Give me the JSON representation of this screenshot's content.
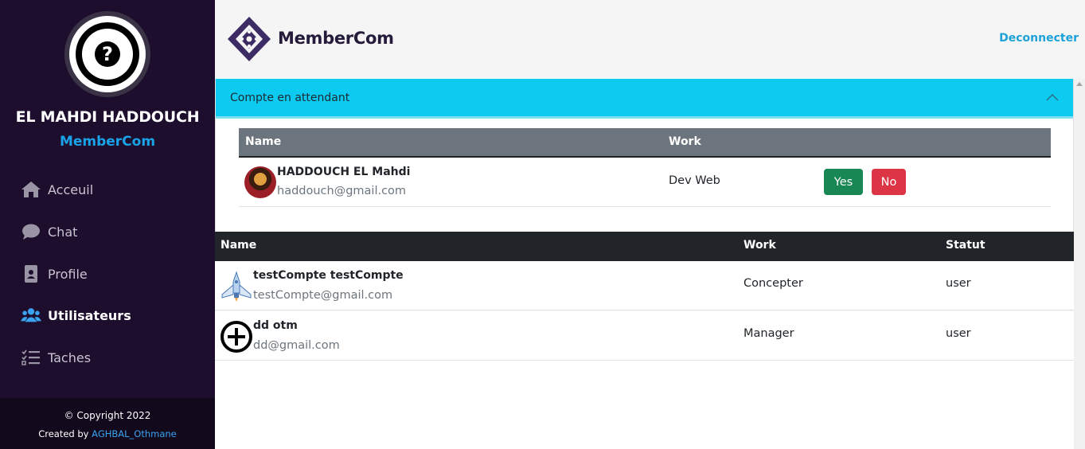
{
  "sidebar": {
    "user_name": "EL MAHDI HADDOUCH",
    "brand": "MemberCom",
    "nav": [
      {
        "label": "Acceuil",
        "icon": "home-icon"
      },
      {
        "label": "Chat",
        "icon": "chat-icon"
      },
      {
        "label": "Profile",
        "icon": "profile-badge-icon"
      },
      {
        "label": "Utilisateurs",
        "icon": "users-icon",
        "active": true
      },
      {
        "label": "Taches",
        "icon": "checklist-icon"
      }
    ],
    "footer": {
      "copyright": "© Copyright 2022",
      "created_by": "Created by",
      "author": "AGHBAL_Othmane"
    }
  },
  "header": {
    "logo_text": "MemberCom",
    "logout_label": "Deconnecter"
  },
  "pending": {
    "title": "Compte en attendant",
    "columns": [
      "Name",
      "Work"
    ],
    "rows": [
      {
        "name": "HADDOUCH EL Mahdi",
        "email": "haddouch@gmail.com",
        "work": "Dev Web",
        "yes_label": "Yes",
        "no_label": "No"
      }
    ]
  },
  "users": {
    "columns": [
      "Name",
      "Work",
      "Statut"
    ],
    "rows": [
      {
        "name": "testCompte testCompte",
        "email": "testCompte@gmail.com",
        "work": "Concepter",
        "statut": "user",
        "icon": "spaceship-icon"
      },
      {
        "name": "dd otm",
        "email": "dd@gmail.com",
        "work": "Manager",
        "statut": "user",
        "icon": "plus-circle-icon"
      }
    ]
  },
  "colors": {
    "sidebar_bg": "#1c0e2c",
    "accent": "#1aa3e8",
    "accordion_header": "#0dcaf0",
    "yes_button": "#198754",
    "no_button": "#dc3545"
  }
}
